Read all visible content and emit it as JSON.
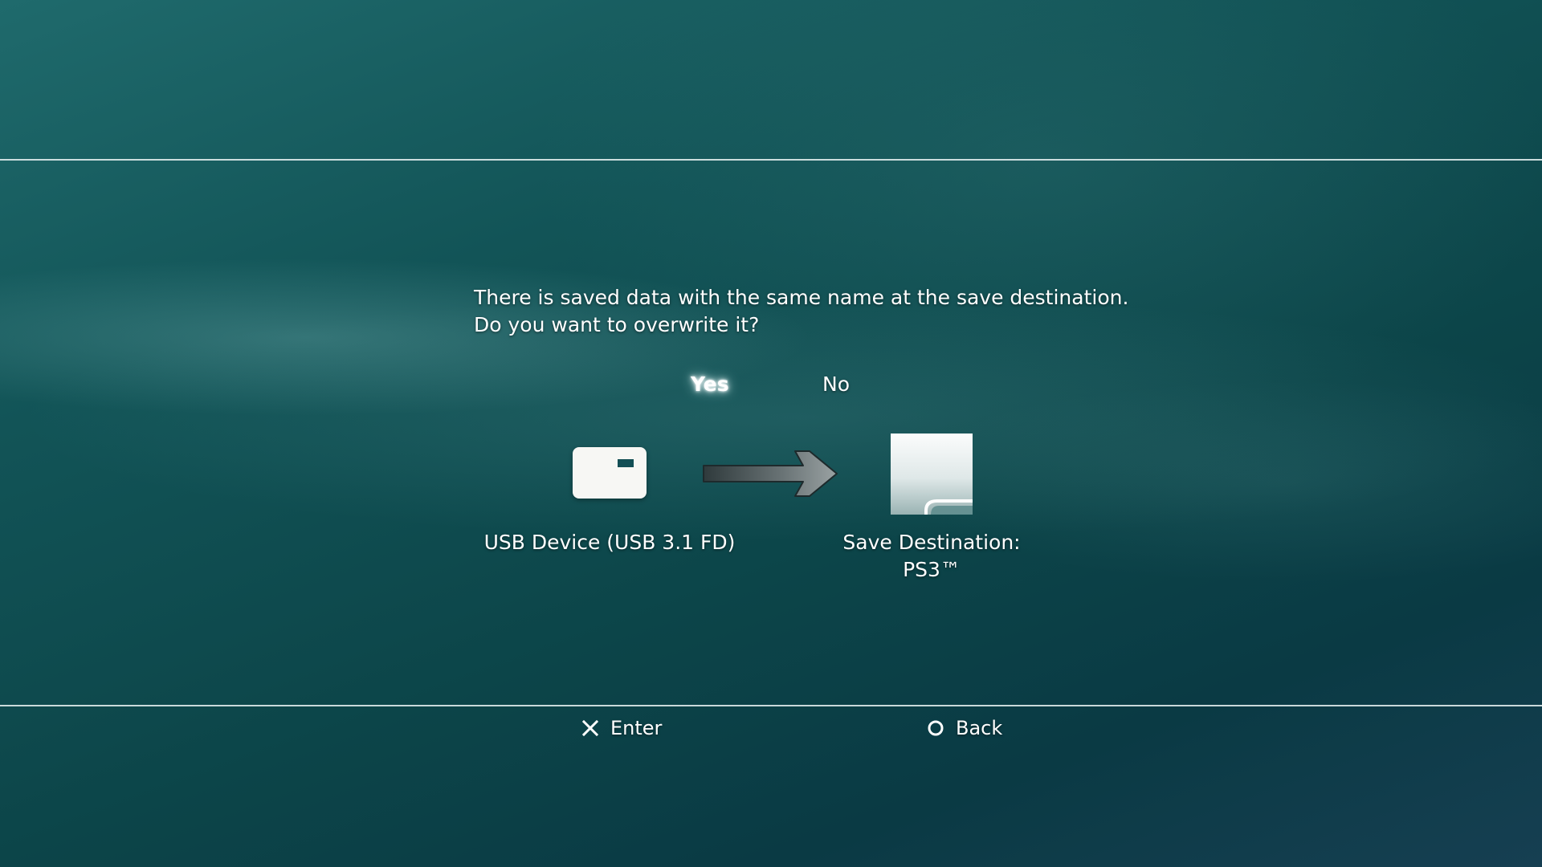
{
  "dialog": {
    "message_lines": [
      "There is saved data with the same name at the save destination.",
      "Do you want to overwrite it?"
    ],
    "options": {
      "yes": "Yes",
      "no": "No",
      "selected": "yes"
    }
  },
  "transfer": {
    "source": {
      "label": "USB Device (USB 3.1 FD)",
      "icon": "usb-device-icon"
    },
    "arrow_icon": "arrow-right-icon",
    "destination": {
      "label_line1": "Save Destination:",
      "label_line2": "PS3™",
      "icon": "ps3-storage-icon"
    }
  },
  "footer": {
    "enter": {
      "icon": "cross-button-icon",
      "label": "Enter"
    },
    "back": {
      "icon": "circle-button-icon",
      "label": "Back"
    }
  },
  "colors": {
    "background_top": "#1f6a6c",
    "background_bottom": "#0a3a44",
    "text": "#ffffff"
  }
}
